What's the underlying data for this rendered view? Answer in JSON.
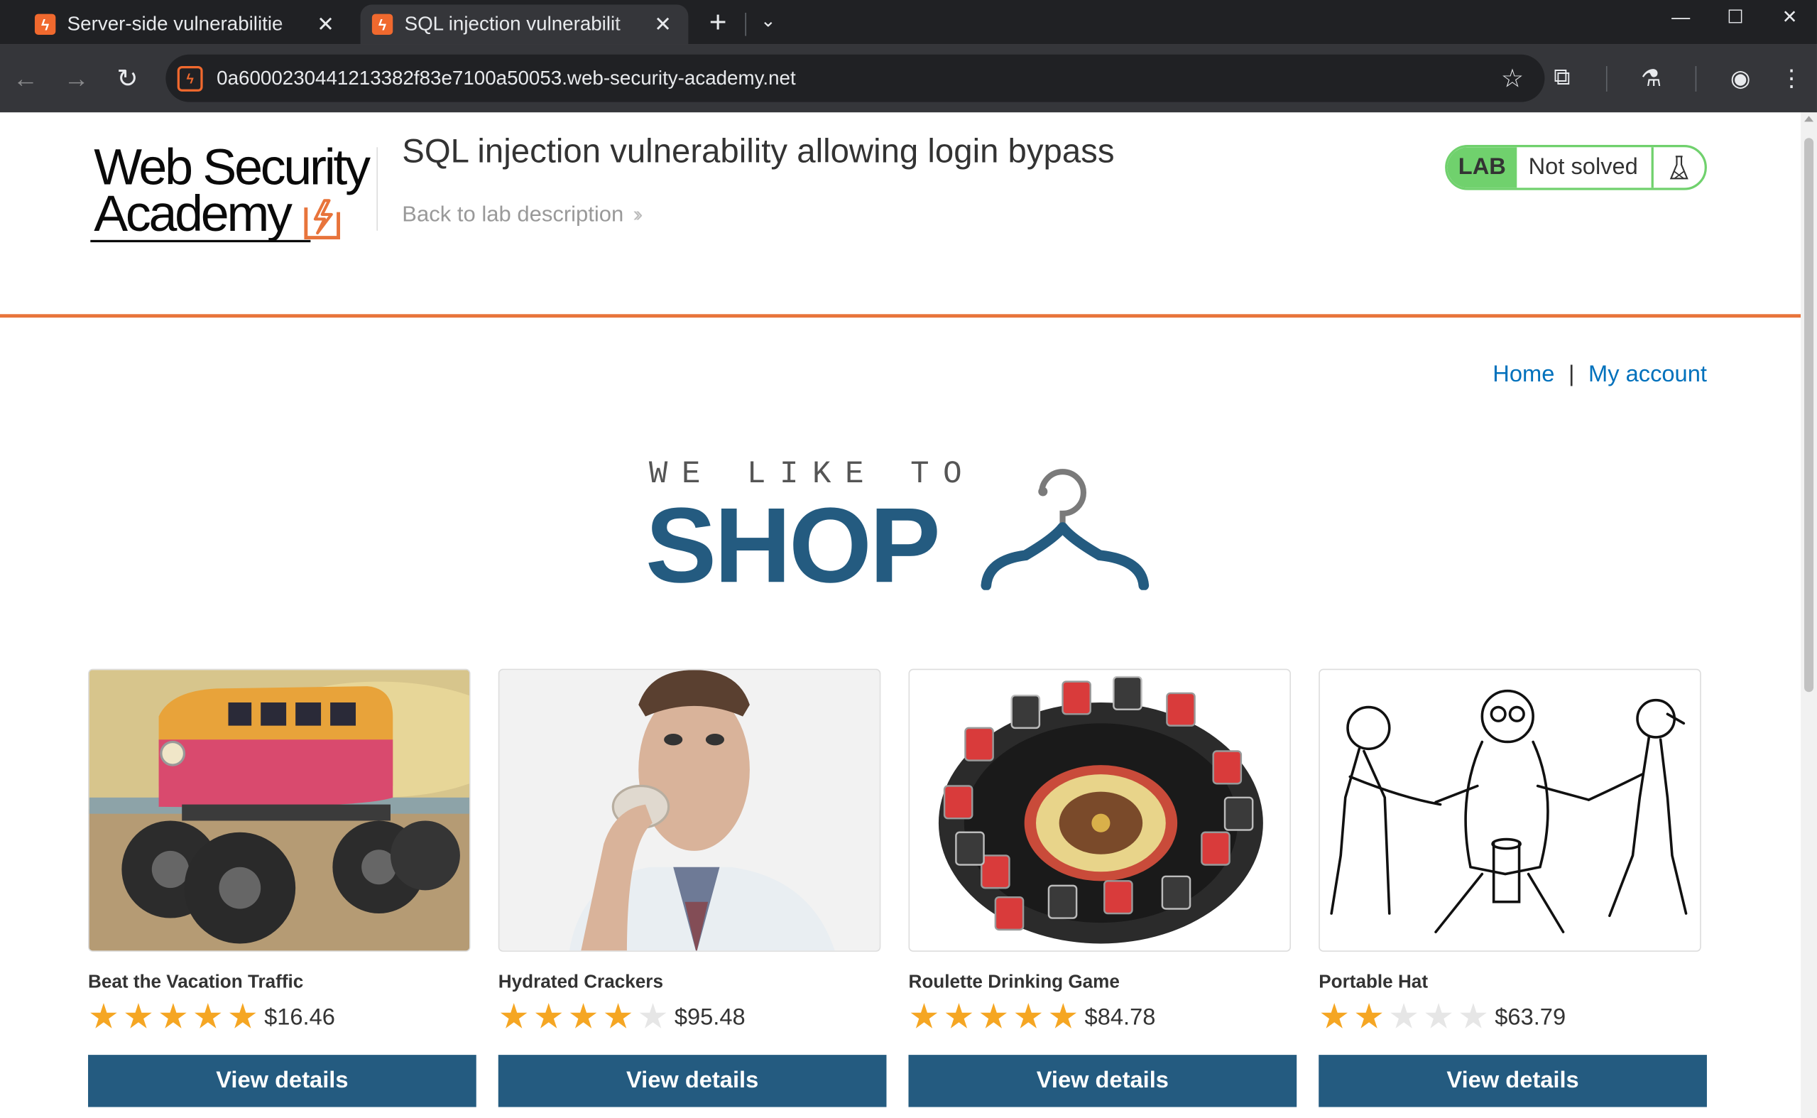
{
  "browser": {
    "tabs": [
      {
        "title": "Server-side vulnerabilitie",
        "active": false
      },
      {
        "title": "SQL injection vulnerabilit",
        "active": true
      }
    ],
    "url": "0a6000230441213382f83e7100a50053.web-security-academy.net"
  },
  "header": {
    "logo_line1": "Web Security",
    "logo_line2": "Academy",
    "lab_title": "SQL injection vulnerability allowing login bypass",
    "back_link": "Back to lab description",
    "lab_tag": "LAB",
    "lab_status": "Not solved"
  },
  "nav": {
    "home": "Home",
    "separator": "|",
    "my_account": "My account"
  },
  "hero": {
    "tagline": "WE LIKE TO",
    "shop": "SHOP"
  },
  "products": [
    {
      "name": "Beat the Vacation Traffic",
      "rating": 5,
      "price": "$16.46",
      "button": "View details",
      "image": "monster-truck-van"
    },
    {
      "name": "Hydrated Crackers",
      "rating": 4,
      "price": "$95.48",
      "button": "View details",
      "image": "man-eating-cracker"
    },
    {
      "name": "Roulette Drinking Game",
      "rating": 5,
      "price": "$84.78",
      "button": "View details",
      "image": "roulette-wheel-shot-glasses"
    },
    {
      "name": "Portable Hat",
      "rating": 2,
      "price": "$63.79",
      "button": "View details",
      "image": "cartoon-people-pulling"
    }
  ],
  "colors": {
    "accent": "#e8743b",
    "brand_blue": "#245b80",
    "link_blue": "#0071bc",
    "lab_green": "#70d16d",
    "star": "#f5a623"
  }
}
